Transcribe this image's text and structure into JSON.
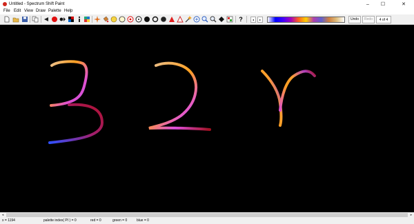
{
  "window": {
    "title": "Untitled - Spectrum Shift Paint",
    "minimize": "–",
    "maximize": "☐",
    "close": "✕"
  },
  "menu": [
    "File",
    "Edit",
    "View",
    "Draw",
    "Palette",
    "Help"
  ],
  "toolbar": {
    "undo_label": "Undo",
    "redo_label": "Redo",
    "page_indicator": "4 of 4",
    "prev_arrow": "◂",
    "next_arrow": "▸",
    "help_glyph": "?"
  },
  "scrollbar": {
    "left": "◂",
    "right": "▸"
  },
  "status": {
    "coords": "x = 1194",
    "palette_index": "palette index( PI ) = 0",
    "red": "red = 0",
    "green": "green = 0",
    "blue = 0": "blue = 0"
  },
  "colors": {
    "canvas_bg": "#000000",
    "accent_red": "#d0261c"
  }
}
